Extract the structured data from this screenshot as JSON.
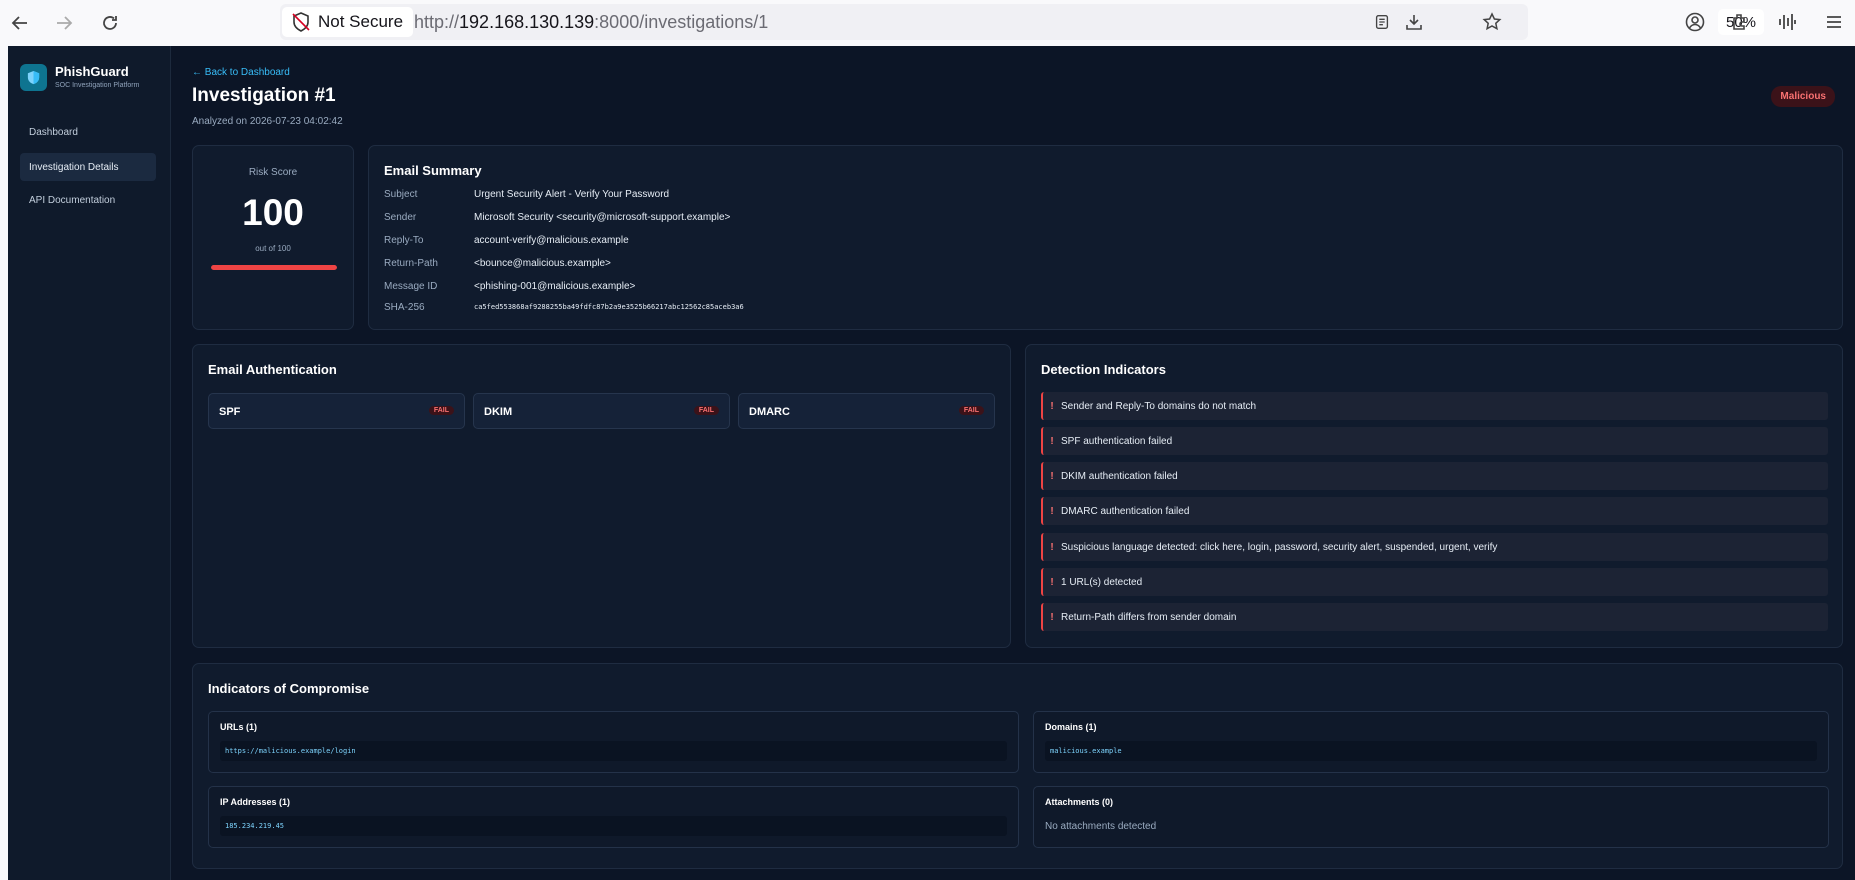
{
  "browser": {
    "security_label": "Not Secure",
    "url_scheme": "http://",
    "url_host": "192.168.130.139",
    "url_rest": ":8000/investigations/1",
    "zoom": "50%"
  },
  "sidebar": {
    "brand_name": "PhishGuard",
    "brand_sub": "SOC Investigation Platform",
    "items": [
      {
        "label": "Dashboard"
      },
      {
        "label": "Investigation Details"
      },
      {
        "label": "API Documentation"
      }
    ]
  },
  "header": {
    "back_link": "← Back to Dashboard",
    "title": "Investigation #1",
    "analyzed": "Analyzed on 2026-07-23 04:02:42",
    "verdict": "Malicious"
  },
  "risk": {
    "label": "Risk Score",
    "value": "100",
    "out_of": "out of 100",
    "fraction": 1.0
  },
  "summary": {
    "title": "Email Summary",
    "rows": [
      {
        "key": "Subject",
        "value": "Urgent Security Alert - Verify Your Password"
      },
      {
        "key": "Sender",
        "value": "Microsoft Security <security@microsoft-support.example>"
      },
      {
        "key": "Reply-To",
        "value": "account-verify@malicious.example"
      },
      {
        "key": "Return-Path",
        "value": "<bounce@malicious.example>"
      },
      {
        "key": "Message ID",
        "value": "<phishing-001@malicious.example>"
      },
      {
        "key": "SHA-256",
        "value": "ca5fed553868af9288255ba49fdfc87b2a9e3525b66217abc12562c85aceb3a6"
      }
    ]
  },
  "auth": {
    "title": "Email Authentication",
    "checks": [
      {
        "name": "SPF",
        "status": "FAIL"
      },
      {
        "name": "DKIM",
        "status": "FAIL"
      },
      {
        "name": "DMARC",
        "status": "FAIL"
      }
    ]
  },
  "detection": {
    "title": "Detection Indicators",
    "items": [
      "Sender and Reply-To domains do not match",
      "SPF authentication failed",
      "DKIM authentication failed",
      "DMARC authentication failed",
      "Suspicious language detected: click here, login, password, security alert, suspended, urgent, verify",
      "1 URL(s) detected",
      "Return-Path differs from sender domain"
    ]
  },
  "ioc": {
    "title": "Indicators of Compromise",
    "urls_title": "URLs (1)",
    "urls": [
      "https://malicious.example/login"
    ],
    "domains_title": "Domains (1)",
    "domains": [
      "malicious.example"
    ],
    "ips_title": "IP Addresses (1)",
    "ips": [
      "185.234.219.45"
    ],
    "attachments_title": "Attachments (0)",
    "attachments_empty": "No attachments detected"
  }
}
